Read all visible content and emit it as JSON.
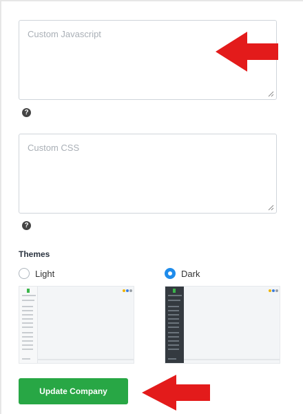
{
  "custom_js": {
    "placeholder": "Custom Javascript"
  },
  "custom_css": {
    "placeholder": "Custom CSS"
  },
  "help_glyph": "?",
  "themes": {
    "label": "Themes",
    "options": [
      {
        "label": "Light",
        "selected": false
      },
      {
        "label": "Dark",
        "selected": true
      }
    ]
  },
  "actions": {
    "update_label": "Update Company"
  },
  "colors": {
    "accent_blue": "#1f8ceb",
    "button_green": "#28a745",
    "arrow_red": "#e31b1b",
    "dark_sidebar": "#343a40"
  },
  "icons": {
    "help": "question-circle-icon",
    "resize": "resize-handle-icon",
    "annotation": "red-arrow-icon"
  }
}
